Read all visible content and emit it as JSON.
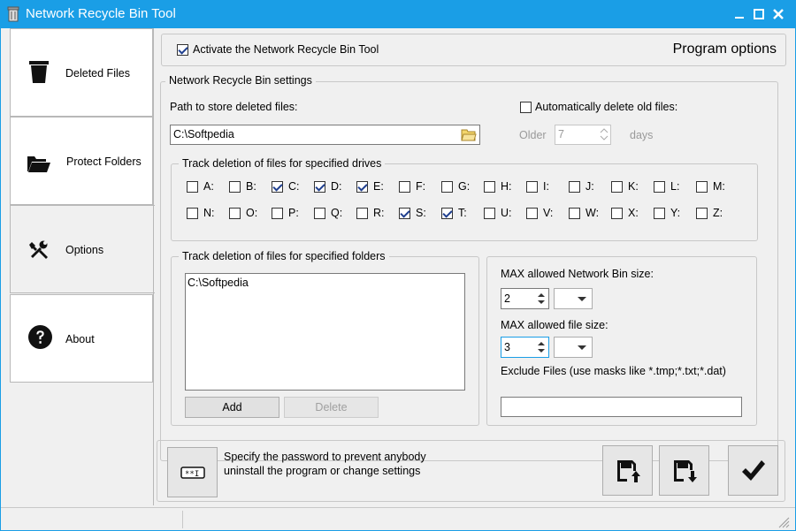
{
  "window": {
    "title": "Network Recycle Bin Tool",
    "accent_color": "#1a9ee6"
  },
  "sidebar": {
    "items": [
      {
        "label": "Deleted Files",
        "icon": "trash-icon"
      },
      {
        "label": "Protect Folders",
        "icon": "folder-open-icon"
      },
      {
        "label": "Options",
        "icon": "tools-icon",
        "active": true
      },
      {
        "label": "About",
        "icon": "question-icon"
      }
    ]
  },
  "header": {
    "activate_label": "Activate the Network Recycle Bin Tool",
    "activate_checked": true,
    "section_title": "Program options"
  },
  "settings": {
    "group_title": "Network Recycle Bin settings",
    "path_label": "Path to store deleted files:",
    "path_value": "C:\\Softpedia",
    "auto_delete_label": "Automatically delete old files:",
    "auto_delete_checked": false,
    "older_label": "Older",
    "older_value": "7",
    "days_label": "days"
  },
  "drives": {
    "group_title": "Track deletion of files for specified drives",
    "row1": [
      {
        "letter": "A:",
        "checked": false
      },
      {
        "letter": "B:",
        "checked": false
      },
      {
        "letter": "C:",
        "checked": true
      },
      {
        "letter": "D:",
        "checked": true
      },
      {
        "letter": "E:",
        "checked": true
      },
      {
        "letter": "F:",
        "checked": false
      },
      {
        "letter": "G:",
        "checked": false
      },
      {
        "letter": "H:",
        "checked": false
      },
      {
        "letter": "I:",
        "checked": false
      },
      {
        "letter": "J:",
        "checked": false
      },
      {
        "letter": "K:",
        "checked": false
      },
      {
        "letter": "L:",
        "checked": false
      },
      {
        "letter": "M:",
        "checked": false
      }
    ],
    "row2": [
      {
        "letter": "N:",
        "checked": false
      },
      {
        "letter": "O:",
        "checked": false
      },
      {
        "letter": "P:",
        "checked": false
      },
      {
        "letter": "Q:",
        "checked": false
      },
      {
        "letter": "R:",
        "checked": false
      },
      {
        "letter": "S:",
        "checked": true
      },
      {
        "letter": "T:",
        "checked": true
      },
      {
        "letter": "U:",
        "checked": false
      },
      {
        "letter": "V:",
        "checked": false
      },
      {
        "letter": "W:",
        "checked": false
      },
      {
        "letter": "X:",
        "checked": false
      },
      {
        "letter": "Y:",
        "checked": false
      },
      {
        "letter": "Z:",
        "checked": false
      }
    ]
  },
  "folders": {
    "group_title": "Track deletion of files for specified folders",
    "items": [
      "C:\\Softpedia"
    ],
    "add_label": "Add",
    "delete_label": "Delete"
  },
  "limits": {
    "max_bin_label": "MAX allowed Network Bin size:",
    "max_bin_value": "2",
    "max_file_label": "MAX allowed file size:",
    "max_file_value": "3",
    "exclude_label": "Exclude Files (use masks like *.tmp;*.txt;*.dat)",
    "exclude_value": ""
  },
  "footer": {
    "password_text_line1": "Specify the password to prevent anybody",
    "password_text_line2": "uninstall the program or change settings",
    "password_icon": "password-icon",
    "export_icon": "save-export-icon",
    "import_icon": "save-import-icon",
    "apply_icon": "checkmark-icon"
  }
}
